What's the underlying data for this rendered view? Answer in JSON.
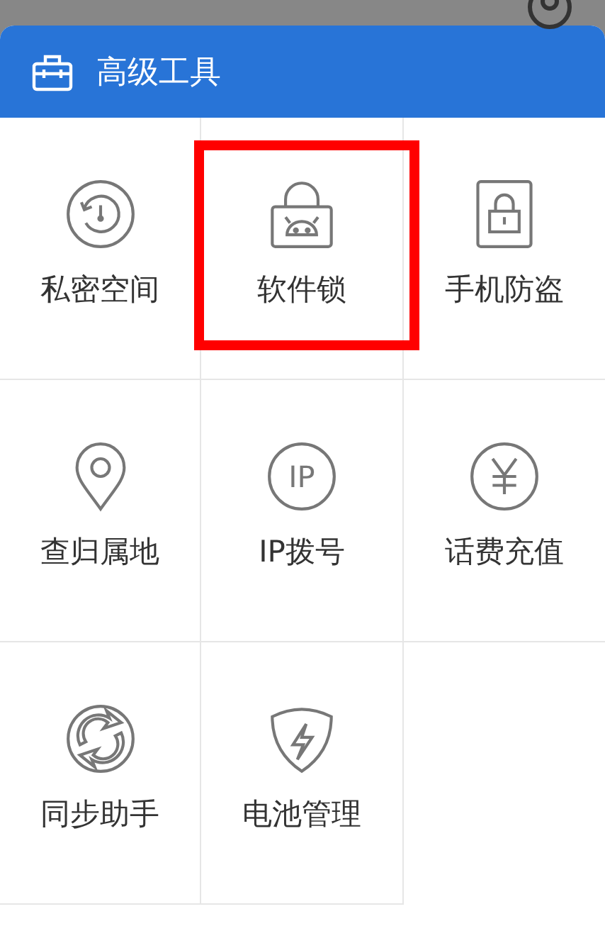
{
  "panel": {
    "title": "高级工具"
  },
  "tools": [
    {
      "label": "私密空间",
      "kind": "timer",
      "highlighted": false
    },
    {
      "label": "软件锁",
      "kind": "applock",
      "highlighted": true
    },
    {
      "label": "手机防盗",
      "kind": "padlock",
      "highlighted": false
    },
    {
      "label": "查归属地",
      "kind": "pin",
      "highlighted": false
    },
    {
      "label": "IP拨号",
      "kind": "ip",
      "icon_text": "IP",
      "highlighted": false
    },
    {
      "label": "话费充值",
      "kind": "yen",
      "highlighted": false
    },
    {
      "label": "同步助手",
      "kind": "sync",
      "highlighted": false
    },
    {
      "label": "电池管理",
      "kind": "bolt",
      "highlighted": false
    }
  ]
}
